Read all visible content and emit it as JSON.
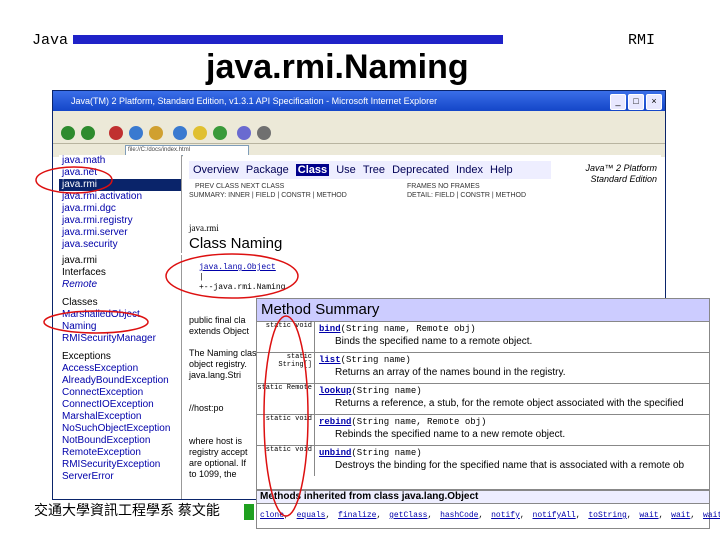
{
  "slide": {
    "left_label": "Java",
    "title": "java.rmi.Naming",
    "right_label": "RMI",
    "footer": "交通大學資訊工程學系 蔡文能"
  },
  "colors": {
    "title_bar": "#1f22c8",
    "annotation": "#dd1010",
    "nav_bg": "#eeeeff",
    "summary_header": "#ccccff"
  },
  "browser": {
    "window_title": "Java(TM) 2 Platform, Standard Edition, v1.3.1 API Specification - Microsoft Internet Explorer",
    "address": "file://C:/docs/index.html"
  },
  "packages": [
    "java.math",
    "java.net",
    "java.rmi",
    "java.rmi.activation",
    "java.rmi.dgc",
    "java.rmi.registry",
    "java.rmi.server",
    "java.security"
  ],
  "classes": {
    "package": "java.rmi",
    "interfaces_label": "Interfaces",
    "interfaces": [
      "Remote"
    ],
    "classes_label": "Classes",
    "class_list": [
      "MarshalledObject",
      "Naming",
      "RMISecurityManager"
    ],
    "exceptions_label": "Exceptions",
    "exception_list": [
      "AccessException",
      "AlreadyBoundException",
      "ConnectException",
      "ConnectIOException",
      "MarshalException",
      "NoSuchObjectException",
      "NotBoundException",
      "RemoteException",
      "RMISecurityException",
      "ServerError"
    ]
  },
  "doc": {
    "nav": [
      "Overview",
      "Package",
      "Class",
      "Use",
      "Tree",
      "Deprecated",
      "Index",
      "Help"
    ],
    "nav_current": "Class",
    "platform": "Java™ 2 Platform Standard Edition",
    "prev_next": "PREV CLASS   NEXT CLASS",
    "frames": "FRAMES   NO FRAMES",
    "summary_line": "SUMMARY: INNER | FIELD | CONSTR | METHOD",
    "detail_line": "DETAIL: FIELD | CONSTR | METHOD",
    "package": "java.rmi",
    "class_title": "Class Naming",
    "hierarchy": [
      "java.lang.Object",
      "|",
      "+--java.rmi.Naming"
    ],
    "left_text": [
      "public final cla",
      "extends Object",
      "",
      "The Naming clas",
      "object registry.",
      "java.lang.Stri",
      "",
      "",
      "//host:po",
      "",
      "",
      "where host is",
      "registry accept",
      "are optional. If",
      "to 1099, the"
    ]
  },
  "summary": {
    "title": "Method Summary",
    "methods": [
      {
        "modifier": "static void",
        "name": "bind",
        "params": "(String name, Remote obj)",
        "desc": "Binds the specified name to a remote object."
      },
      {
        "modifier": "static String[]",
        "name": "list",
        "params": "(String name)",
        "desc": "Returns an array of the names bound in the registry."
      },
      {
        "modifier": "static Remote",
        "name": "lookup",
        "params": "(String name)",
        "desc": "Returns a reference, a stub, for the remote object associated with the specified"
      },
      {
        "modifier": "static void",
        "name": "rebind",
        "params": "(String name, Remote obj)",
        "desc": "Rebinds the specified name to a new remote object."
      },
      {
        "modifier": "static void",
        "name": "unbind",
        "params": "(String name)",
        "desc": "Destroys the binding for the specified name that is associated with a remote ob"
      }
    ],
    "inherited_title": "Methods inherited from class java.lang.Object",
    "inherited": [
      "clone",
      "equals",
      "finalize",
      "getClass",
      "hashCode",
      "notify",
      "notifyAll",
      "toString",
      "wait",
      "wait",
      "wait"
    ]
  }
}
